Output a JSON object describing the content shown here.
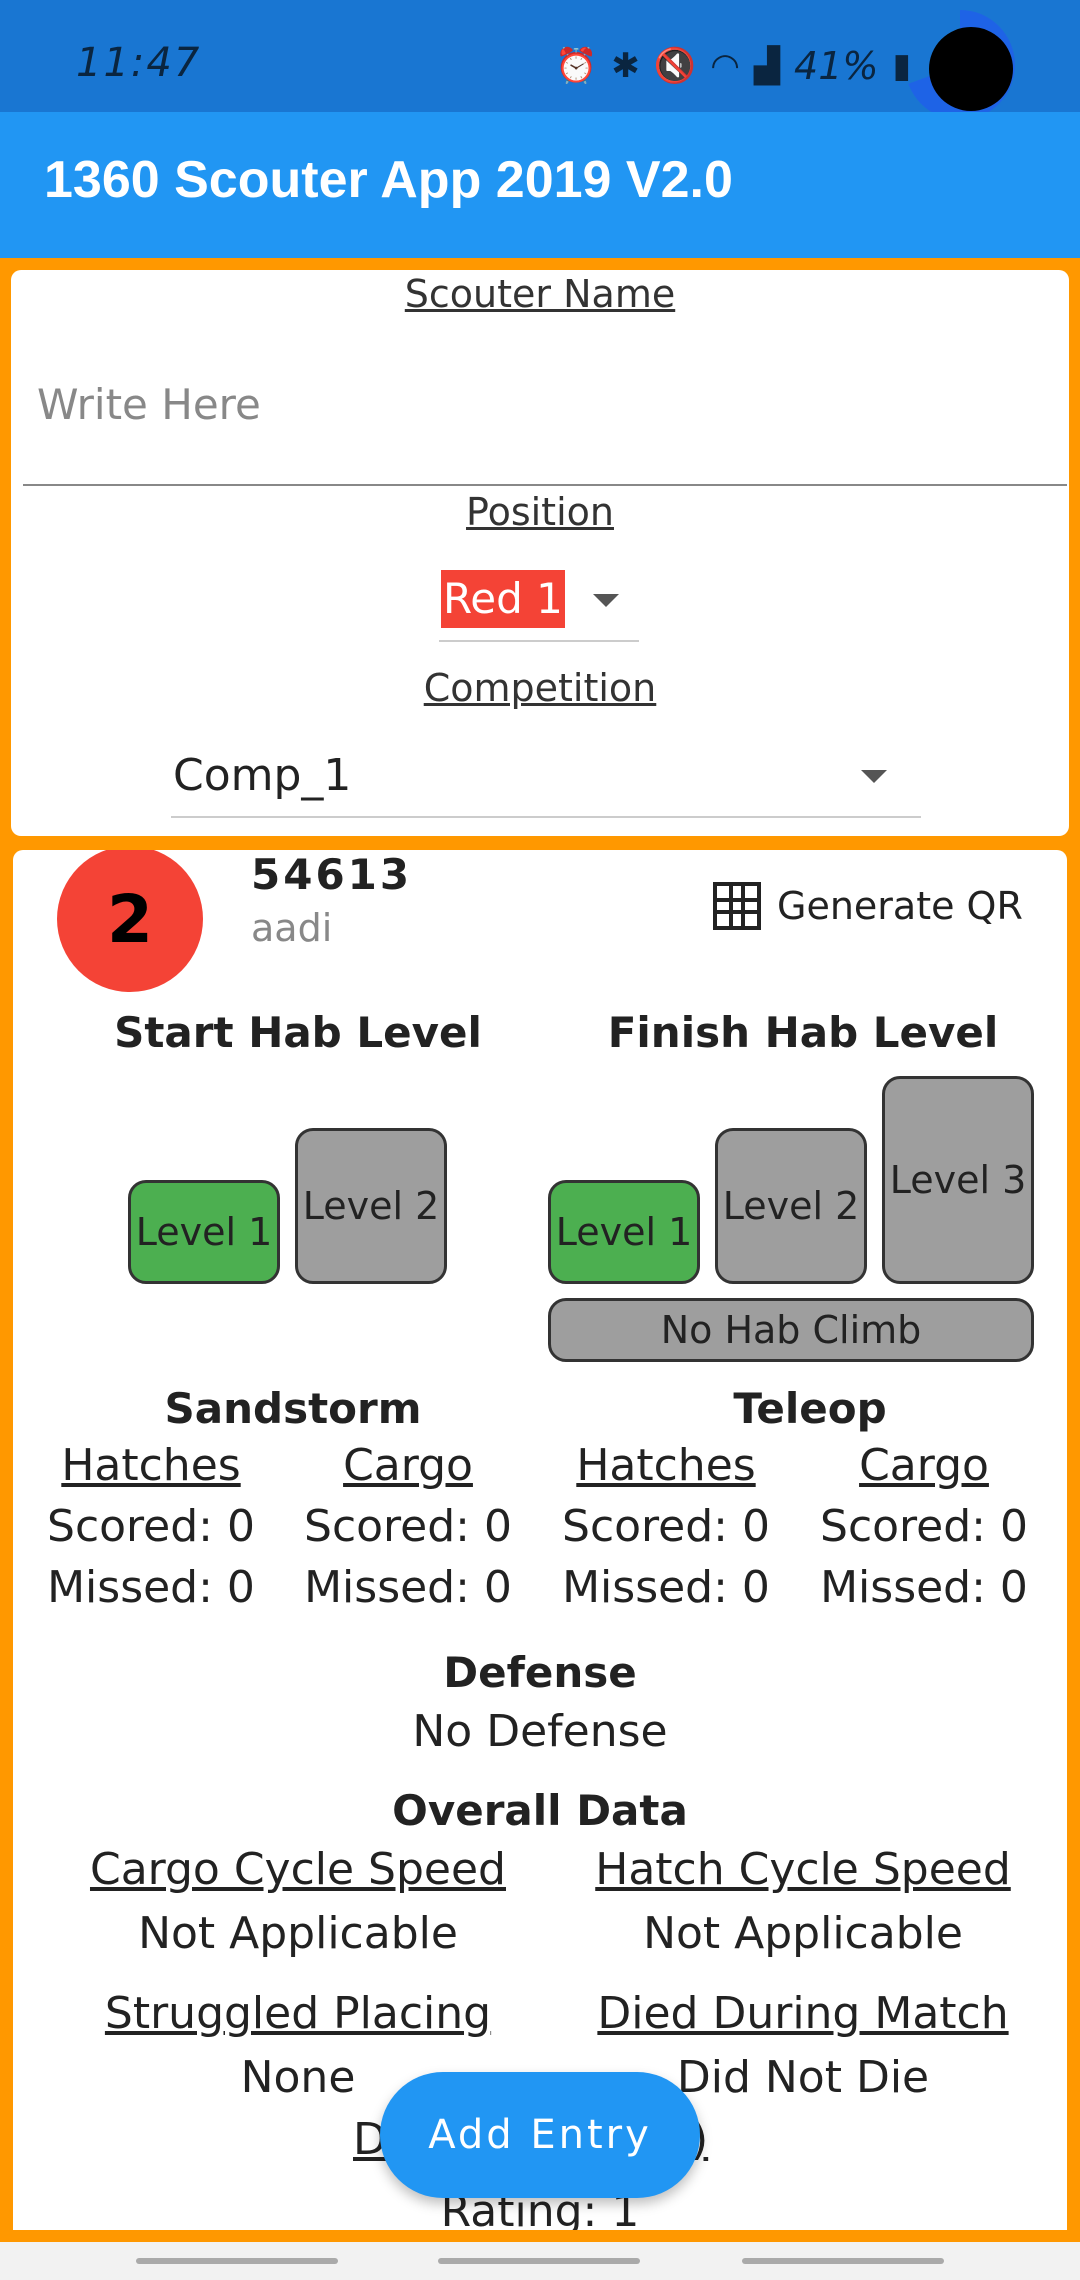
{
  "status_bar": {
    "time": "11:47",
    "icons": [
      "alarm-icon",
      "bluetooth-icon",
      "mute-icon",
      "wifi-icon",
      "signal-icon"
    ],
    "battery_text": "41%"
  },
  "app_bar": {
    "title": "1360 Scouter App 2019 V2.0"
  },
  "form": {
    "scouter_label": "Scouter Name",
    "scouter_placeholder": "Write Here",
    "position_label": "Position",
    "position_value": "Red 1",
    "competition_label": "Competition",
    "competition_value": "Comp_1"
  },
  "record": {
    "match_number": "2",
    "team_number": "54613",
    "scouter": "aadi",
    "generate_qr": "Generate QR",
    "start_hab_title": "Start Hab Level",
    "finish_hab_title": "Finish Hab Level",
    "start_levels": [
      {
        "label": "Level 1",
        "selected": true
      },
      {
        "label": "Level 2",
        "selected": false
      }
    ],
    "finish_levels": [
      {
        "label": "Level 1",
        "selected": true
      },
      {
        "label": "Level 2",
        "selected": false
      },
      {
        "label": "Level 3",
        "selected": false
      }
    ],
    "no_hab_climb": "No Hab Climb",
    "sandstorm_title": "Sandstorm",
    "teleop_title": "Teleop",
    "columns": [
      {
        "header": "Hatches",
        "scored": "Scored: 0",
        "missed": "Missed: 0"
      },
      {
        "header": "Cargo",
        "scored": "Scored: 0",
        "missed": "Missed: 0"
      },
      {
        "header": "Hatches",
        "scored": "Scored: 0",
        "missed": "Missed: 0"
      },
      {
        "header": "Cargo",
        "scored": "Scored: 0",
        "missed": "Missed: 0"
      }
    ],
    "defense_title": "Defense",
    "defense_value": "No Defense",
    "overall_title": "Overall Data",
    "cargo_cycle_label": "Cargo Cycle Speed",
    "cargo_cycle_value": "Not Applicable",
    "hatch_cycle_label": "Hatch Cycle Speed",
    "hatch_cycle_value": "Not Applicable",
    "struggled_label": "Struggled Placing",
    "struggled_value": "None",
    "died_label": "Died During Match",
    "died_value": "Did Not Die",
    "partial_label_left": "D",
    "partial_label_right": "5)",
    "rating": "Rating: 1"
  },
  "fab": {
    "label": "Add Entry"
  }
}
